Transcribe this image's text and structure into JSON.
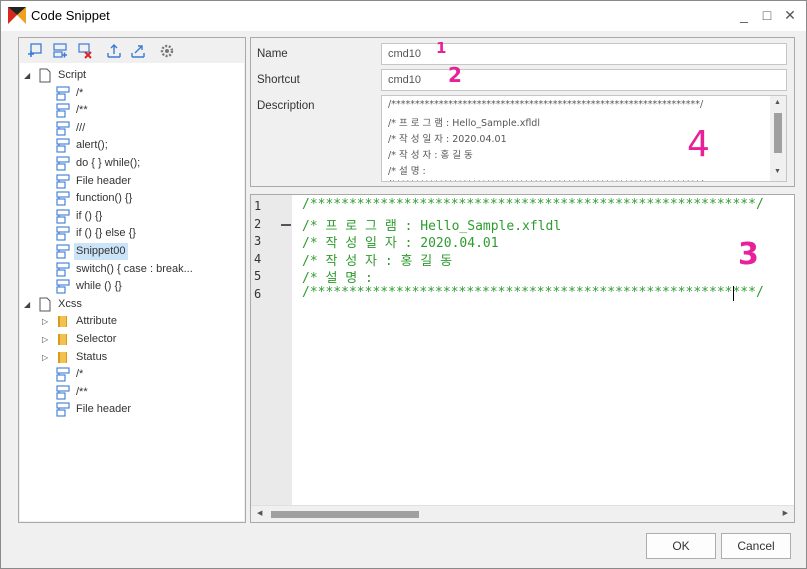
{
  "window": {
    "title": "Code Snippet",
    "controls": [
      "_",
      "□",
      "✕"
    ]
  },
  "toolbar": {
    "icons": [
      "add-child-icon",
      "add-sibling-icon",
      "delete-icon",
      "import-icon",
      "export-icon",
      "settings-icon"
    ]
  },
  "tree": {
    "script_group": "Script",
    "script_items": [
      "/*",
      "/**",
      "///",
      "alert();",
      "do { } while();",
      "File header",
      "function() {}",
      "if () {}",
      "if () {} else {}",
      "Snippet00",
      "switch() { case : break...",
      "while () {}"
    ],
    "selected": "Snippet00",
    "xcss_group": "Xcss",
    "xcss_folders": [
      "Attribute",
      "Selector",
      "Status"
    ],
    "xcss_items": [
      "/*",
      "/**",
      "File header"
    ]
  },
  "form": {
    "name_label": "Name",
    "name_value": "cmd10",
    "shortcut_label": "Shortcut",
    "shortcut_value": "cmd10",
    "description_label": "Description",
    "description_lines": [
      "/*****************************************************************/",
      "/* 프 로 그 램 : Hello_Sample.xfldl",
      "/* 작 성 일 자 : 2020.04.01",
      "/* 작  성   자 : 홍 길 동",
      "/* 설      명 :",
      "/*****************************************************************/"
    ]
  },
  "editor": {
    "line_numbers": [
      "1",
      "2",
      "3",
      "4",
      "5",
      "6"
    ],
    "lines": [
      "/*********************************************************/",
      "/* 프 로 그 램 : Hello_Sample.xfldl",
      "/* 작 성 일 자 : 2020.04.01",
      "/* 작  성   자 : 홍 길 동",
      "/* 설      명 :",
      "/*********************************************************/"
    ]
  },
  "buttons": {
    "ok": "OK",
    "cancel": "Cancel"
  },
  "annotations": [
    "1",
    "2",
    "3",
    "4"
  ],
  "colors": {
    "code_green": "#2e9b2e",
    "annotation_pink": "#e8209a",
    "selection_blue": "#cce4f7"
  }
}
